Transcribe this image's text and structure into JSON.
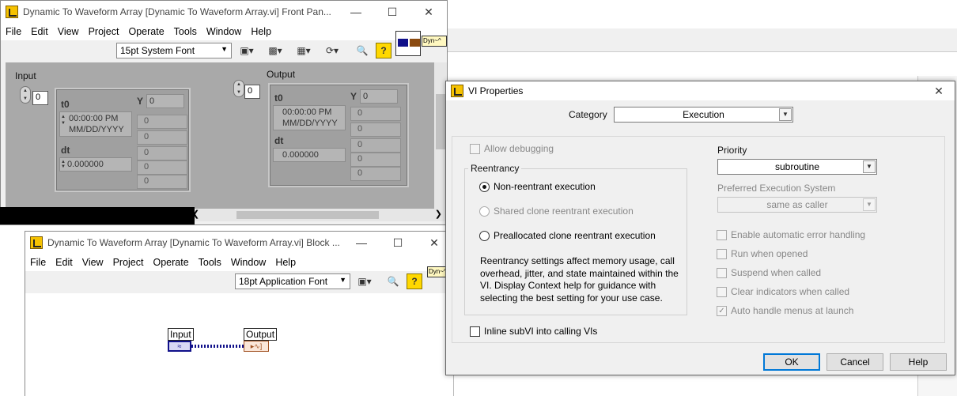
{
  "front_panel": {
    "title": "Dynamic To Waveform Array [Dynamic To Waveform Array.vi] Front Pan...",
    "menu": [
      "File",
      "Edit",
      "View",
      "Project",
      "Operate",
      "Tools",
      "Window",
      "Help"
    ],
    "font": "15pt System Font",
    "connector_label": "Dyn",
    "input": {
      "label": "Input",
      "index": "0",
      "t0_label": "t0",
      "t0_time": "00:00:00 PM",
      "t0_date": "MM/DD/YYYY",
      "dt_label": "dt",
      "dt_value": "0.000000",
      "y_label": "Y",
      "y_index": "0",
      "y_values": [
        "0",
        "0",
        "0",
        "0",
        "0",
        "0"
      ]
    },
    "output": {
      "label": "Output",
      "index": "0",
      "t0_label": "t0",
      "t0_time": "00:00:00 PM",
      "t0_date": "MM/DD/YYYY",
      "dt_label": "dt",
      "dt_value": "0.000000",
      "y_label": "Y",
      "y_index": "0",
      "y_values": [
        "0",
        "0",
        "0",
        "0",
        "0",
        "0"
      ]
    }
  },
  "block_diagram": {
    "title": "Dynamic To Waveform Array [Dynamic To Waveform Array.vi] Block ...",
    "menu": [
      "File",
      "Edit",
      "View",
      "Project",
      "Operate",
      "Tools",
      "Window",
      "Help"
    ],
    "font": "18pt Application Font",
    "connector_label": "Dyn",
    "input_terminal": "Input",
    "output_terminal": "Output"
  },
  "dialog": {
    "title": "VI Properties",
    "category_label": "Category",
    "category_value": "Execution",
    "allow_debugging": "Allow debugging",
    "reentrancy_label": "Reentrancy",
    "radio_nonreentrant": "Non-reentrant execution",
    "radio_shared": "Shared clone reentrant execution",
    "radio_preallocated": "Preallocated clone reentrant execution",
    "reentrancy_help": "Reentrancy settings affect memory usage, call overhead, jitter, and state maintained within the VI. Display Context help for guidance with selecting the best setting for your use case.",
    "inline_subvi": "Inline subVI into calling VIs",
    "priority_label": "Priority",
    "priority_value": "subroutine",
    "exec_system_label": "Preferred Execution System",
    "exec_system_value": "same as caller",
    "opt_error_handling": "Enable automatic error handling",
    "opt_run_when_opened": "Run when opened",
    "opt_suspend": "Suspend when called",
    "opt_clear_indicators": "Clear indicators when called",
    "opt_auto_menus": "Auto handle menus at launch",
    "ok": "OK",
    "cancel": "Cancel",
    "help": "Help"
  }
}
